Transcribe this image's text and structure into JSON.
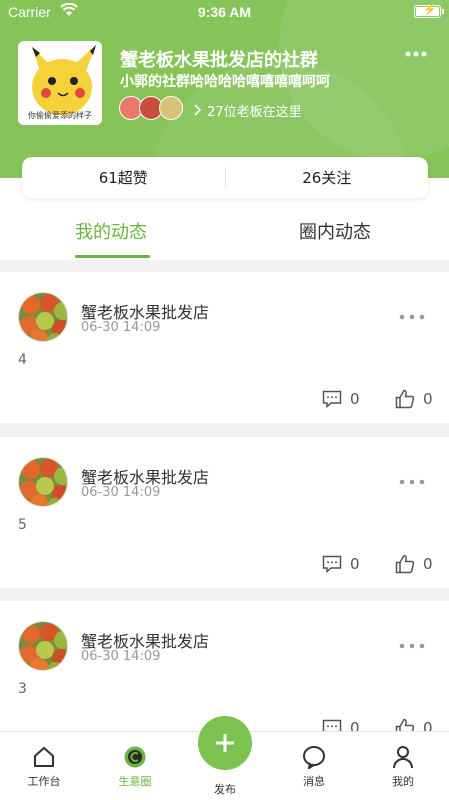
{
  "status_bar": {
    "carrier": "Carrier",
    "time": "9:36 AM"
  },
  "header": {
    "group_name": "蟹老板水果批发店的社群",
    "group_desc": "小郭的社群哈哈哈哈嘻嘻嘻嘻呵呵",
    "avatar_caption": "你偷偷爱添的样子",
    "member_text": "27位老板在这里"
  },
  "stats": {
    "likes": "61超赞",
    "follows": "26关注"
  },
  "tabs": [
    {
      "label": "我的动态"
    },
    {
      "label": "圈内动态"
    }
  ],
  "posts": [
    {
      "name": "蟹老板水果批发店",
      "date": "06-30 14:09",
      "body": "4",
      "comments": "0",
      "likes": "0"
    },
    {
      "name": "蟹老板水果批发店",
      "date": "06-30 14:09",
      "body": "5",
      "comments": "0",
      "likes": "0"
    },
    {
      "name": "蟹老板水果批发店",
      "date": "06-30 14:09",
      "body": "3",
      "comments": "0",
      "likes": "0"
    }
  ],
  "tabbar": {
    "items": [
      {
        "label": "工作台",
        "icon": "home-icon"
      },
      {
        "label": "生意圈",
        "icon": "circle-icon"
      },
      {
        "label": "发布",
        "icon": "plus-icon"
      },
      {
        "label": "消息",
        "icon": "message-icon"
      },
      {
        "label": "我的",
        "icon": "person-icon"
      }
    ]
  },
  "colors": {
    "brand": "#86c45a",
    "accent": "#6ab53f"
  }
}
